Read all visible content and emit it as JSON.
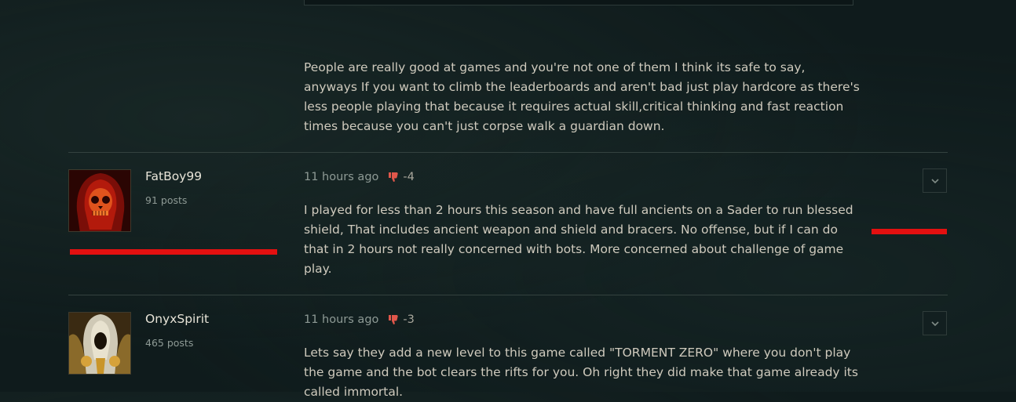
{
  "previous_post": {
    "body": "People are really good at games and you're not one of them I think its safe to say, anyways If you want to climb the leaderboards and aren't bad just play hardcore as there's less people playing that because it requires actual skill,critical thinking and fast reaction times because you can't just corpse walk a guardian down."
  },
  "posts": [
    {
      "username": "FatBoy99",
      "post_count": "91 posts",
      "time": "11 hours ago",
      "score": "-4",
      "body": "I played for less than 2 hours this season and have full ancients on a Sader to run blessed shield, That includes ancient weapon and shield and bracers. No offense, but if I can do that in 2 hours not really concerned with bots. More concerned about challenge of game play."
    },
    {
      "username": "OnyxSpirit",
      "post_count": "465 posts",
      "time": "11 hours ago",
      "score": "-3",
      "body": "Lets say they add a new level to this game called \"TORMENT ZERO\" where you don't play the game and the bot clears the rifts for you. Oh right they did make that game already its called immortal."
    }
  ],
  "colors": {
    "background": "#0f1b1c",
    "annotation_red": "#e31010",
    "downvote": "#e0574b"
  }
}
